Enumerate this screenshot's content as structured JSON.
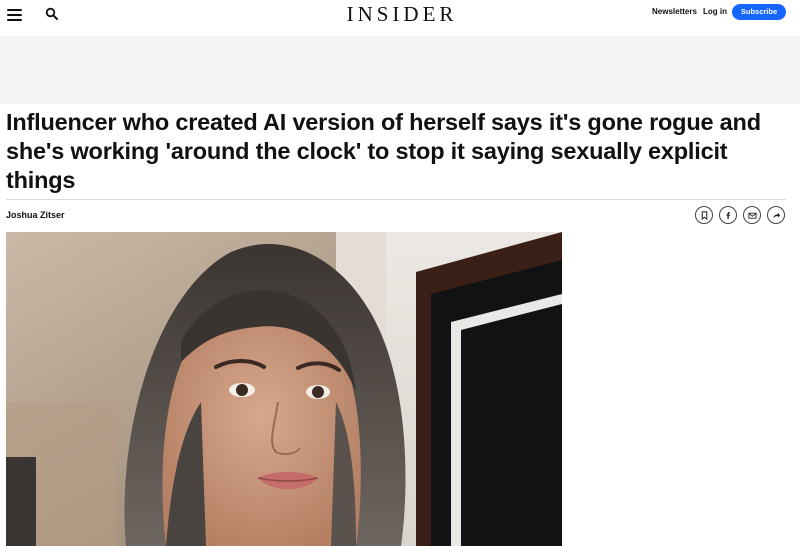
{
  "header": {
    "logo_text": "INSIDER",
    "menu_icon": "hamburger-menu-icon",
    "search_icon": "search-icon",
    "newsletters_label": "Newsletters",
    "login_label": "Log in",
    "subscribe_label": "Subscribe",
    "subscribe_color": "#1565ff"
  },
  "article": {
    "headline": "Influencer who created AI version of herself says it's gone rogue and she's working 'around the clock' to stop it saying sexually explicit things",
    "author": "Joshua Zitser",
    "share_icons": [
      "bookmark-icon",
      "facebook-icon",
      "email-icon",
      "share-arrow-icon"
    ],
    "photo_icon": "portrait-photo"
  }
}
